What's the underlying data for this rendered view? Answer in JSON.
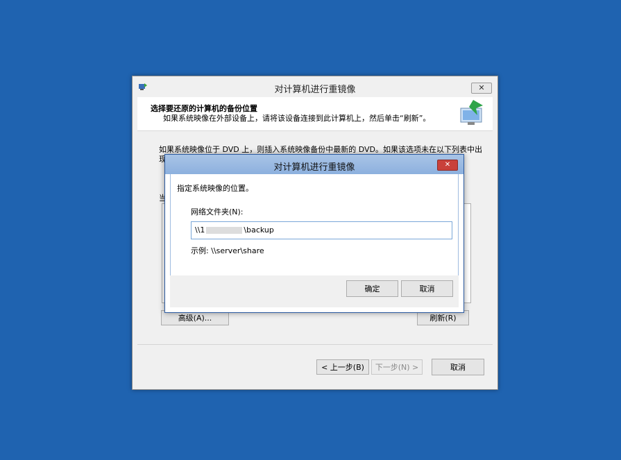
{
  "main_window": {
    "title": "对计算机进行重镜像",
    "close_label": "✕",
    "header_title": "选择要还原的计算机的备份位置",
    "header_subtitle": "如果系统映像在外部设备上，请将该设备连接到此计算机上，然后单击“刷新”。",
    "body_line1": "如果系统映像位于 DVD 上，则插入系统映像备份中最新的 DVD。如果该选项未在以下列表中出",
    "body_line2_fragment": "现",
    "list_label_fragment": "当",
    "advanced_button": "高级(A)...",
    "refresh_button": "刷新(R)",
    "back_button": "< 上一步(B)",
    "next_button": "下一步(N) >",
    "cancel_button": "取消"
  },
  "dialog": {
    "title": "对计算机进行重镜像",
    "close_label": "✕",
    "instruction": "指定系统映像的位置。",
    "field_label": "网络文件夹(N):",
    "field_value_prefix": "\\\\1",
    "field_value_suffix": "\\backup",
    "example": "示例: \\\\server\\share",
    "ok_button": "确定",
    "cancel_button": "取消"
  }
}
